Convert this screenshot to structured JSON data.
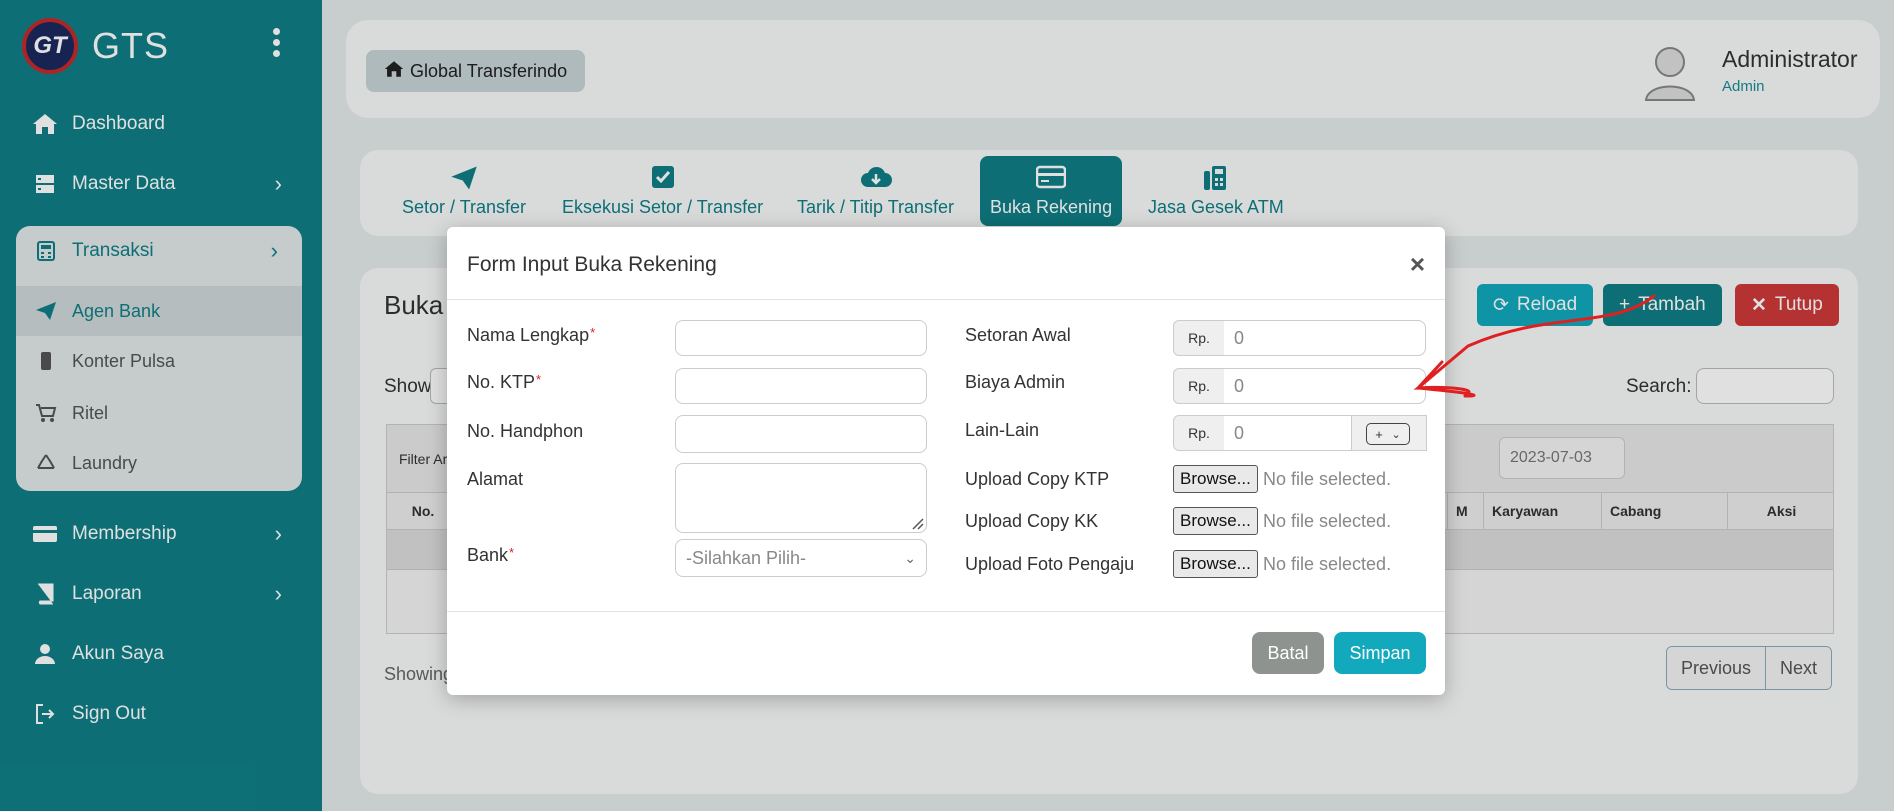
{
  "app": {
    "brand": "GTS",
    "logo_text": "GT"
  },
  "sidebar": {
    "items": [
      {
        "label": "Dashboard",
        "icon": "home-icon"
      },
      {
        "label": "Master Data",
        "icon": "server-icon"
      },
      {
        "label": "Transaksi",
        "icon": "calculator-icon"
      },
      {
        "label": "Agen Bank",
        "icon": "paper-plane-icon"
      },
      {
        "label": "Konter Pulsa",
        "icon": "mobile-icon"
      },
      {
        "label": "Ritel",
        "icon": "cart-icon"
      },
      {
        "label": "Laundry",
        "icon": "recycle-icon"
      },
      {
        "label": "Membership",
        "icon": "card-icon"
      },
      {
        "label": "Laporan",
        "icon": "book-icon"
      },
      {
        "label": "Akun Saya",
        "icon": "user-icon"
      },
      {
        "label": "Sign Out",
        "icon": "sign-out-icon"
      }
    ]
  },
  "header": {
    "home_label": "Global Transferindo",
    "user_name": "Administrator",
    "user_role": "Admin"
  },
  "tabs": [
    {
      "label": "Setor / Transfer",
      "icon": "paper-plane-icon"
    },
    {
      "label": "Eksekusi Setor / Transfer",
      "icon": "check-square-icon"
    },
    {
      "label": "Tarik / Titip Transfer",
      "icon": "cloud-download-icon"
    },
    {
      "label": "Buka Rekening",
      "icon": "credit-card-icon"
    },
    {
      "label": "Jasa Gesek ATM",
      "icon": "fax-icon"
    }
  ],
  "content": {
    "title": "Buka",
    "buttons": {
      "reload": "Reload",
      "tambah": "Tambah",
      "tutup": "Tutup"
    },
    "show_label": "Show",
    "search_label": "Search:",
    "filter_label": "Filter Ar",
    "date_value": "2023-07-03",
    "columns": [
      "No.",
      "M",
      "Karyawan",
      "Cabang",
      "Aksi"
    ],
    "showing": "Showing",
    "pager": {
      "previous": "Previous",
      "next": "Next"
    }
  },
  "modal": {
    "title": "Form Input Buka Rekening",
    "close": "×",
    "left_fields": {
      "nama": "Nama Lengkap",
      "ktp": "No. KTP",
      "hp": "No. Handphon",
      "alamat": "Alamat",
      "bank": "Bank",
      "bank_placeholder": "-Silahkan Pilih-",
      "required_mark": "*"
    },
    "right_fields": {
      "setoran": "Setoran Awal",
      "biaya": "Biaya Admin",
      "lain": "Lain-Lain",
      "currency": "Rp.",
      "amount_placeholder": "0",
      "op": "+",
      "upload_ktp": "Upload Copy KTP",
      "upload_kk": "Upload Copy KK",
      "upload_foto": "Upload Foto Pengaju",
      "browse": "Browse...",
      "no_file": "No file selected."
    },
    "buttons": {
      "batal": "Batal",
      "simpan": "Simpan"
    }
  },
  "colors": {
    "primary": "#0f7f86",
    "accent": "#12a9bd",
    "danger": "#cf3a3a",
    "annotation": "#e02020"
  }
}
